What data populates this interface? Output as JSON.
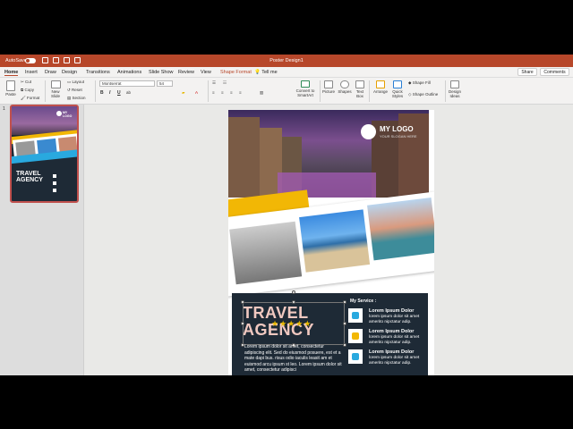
{
  "titlebar": {
    "autosave": "AutoSave",
    "toggle_state": "OFF",
    "document": "Poster Design1"
  },
  "tabs": [
    "Home",
    "Insert",
    "Draw",
    "Design",
    "Transitions",
    "Animations",
    "Slide Show",
    "Review",
    "View",
    "Shape Format",
    "Tell me"
  ],
  "actions": {
    "share": "Share",
    "comments": "Comments"
  },
  "ribbon": {
    "paste": "Paste",
    "cut": "Cut",
    "copy": "Copy",
    "format": "Format",
    "new_slide": "New\nSlide",
    "layout": "Layout",
    "reset": "Reset",
    "section": "Section",
    "font_name": "Montserrat",
    "font_size": "54",
    "bold": "B",
    "italic": "I",
    "underline": "U",
    "convert_smartart": "Convert to\nSmartArt",
    "picture": "Picture",
    "shapes": "Shapes",
    "text_box": "Text\nBox",
    "arrange": "Arrange",
    "quick_styles": "Quick\nStyles",
    "shape_fill": "Shape Fill",
    "shape_outline": "Shape Outline",
    "design_ideas": "Design\nIdeas"
  },
  "thumbnail": {
    "number": "1",
    "logo": "MY LOGO",
    "title": "TRAVEL AGENCY"
  },
  "slide": {
    "logo": "MY LOGO",
    "logo_sub": "YOUR SLOGAN HERE",
    "headline_1": "TRAVEL",
    "headline_2": "AGENCY",
    "stars": "★★★★★",
    "services_title": "My Service :",
    "body_left": "Lorem ipsum dolor sit amet, consectetur adipiscing elit. Sed do eiusmod posuere, est et a mate dapi bus. risus odio iaculis leasit am et euismod arcu ipsum st leo. Lorem ipsum dolor sit amet, consectetur adipisci",
    "services": [
      {
        "heading": "Lorem Ipsum Dolor",
        "body": "lorem ipsum dolor sit amet amerito nipctatur adip."
      },
      {
        "heading": "Lorem Ipsum Dolor",
        "body": "lorem ipsum dolor sit amet amerito nipctatur adip."
      },
      {
        "heading": "Lorem Ipsum Dolor",
        "body": "lorem ipsum dolor sit amet amerito nipctatur adip."
      }
    ]
  },
  "colors": {
    "accent": "#b7472a",
    "yellow": "#f2b705",
    "blue": "#29a9df",
    "dark": "#1e2a36",
    "grey_box": "#808080"
  }
}
